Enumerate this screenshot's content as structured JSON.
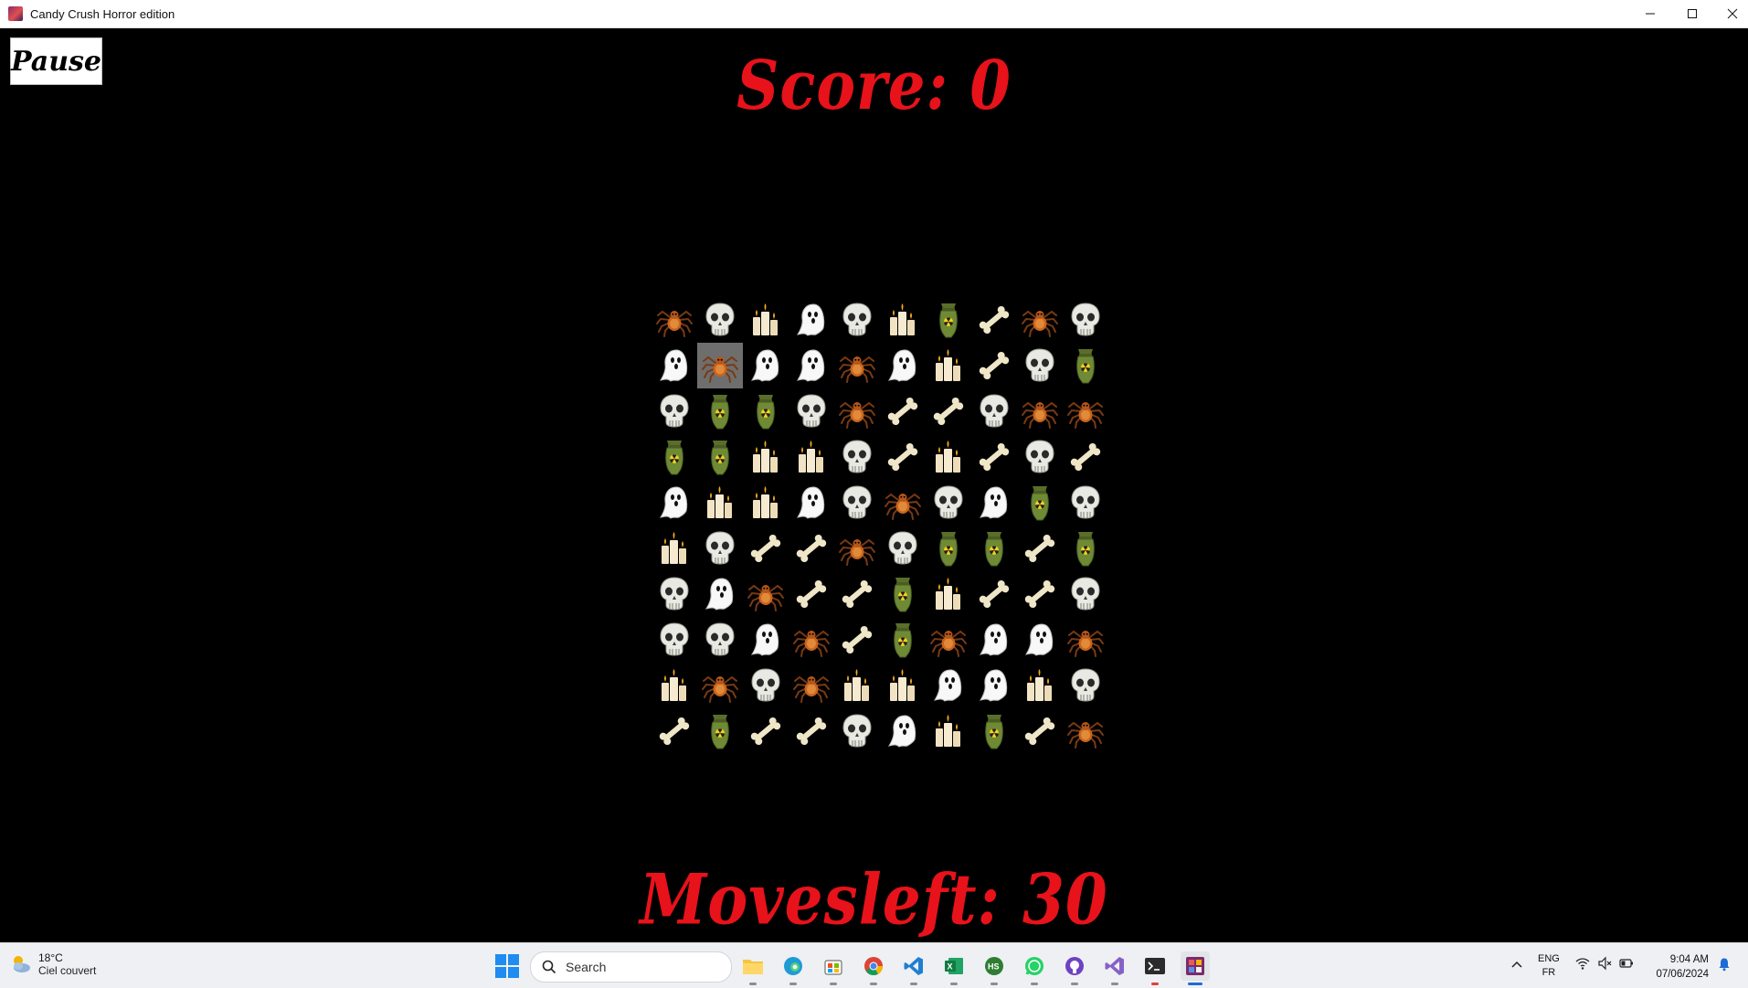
{
  "window": {
    "title": "Candy Crush Horror edition"
  },
  "game": {
    "pause_label": "Pause",
    "score_label": "Score: 0",
    "moves_label": "Movesleft: 30",
    "board_rows": [
      [
        "spider",
        "skull",
        "candles",
        "ghost",
        "skull",
        "candles",
        "bomb",
        "bone",
        "spider",
        "skull"
      ],
      [
        "ghost",
        "spider",
        "ghost",
        "ghost",
        "spider",
        "ghost",
        "candles",
        "bone",
        "skull",
        "bomb"
      ],
      [
        "skull",
        "bomb",
        "bomb",
        "skull",
        "spider",
        "bone",
        "bone",
        "skull",
        "spider",
        "spider"
      ],
      [
        "bomb",
        "bomb",
        "candles",
        "candles",
        "skull",
        "bone",
        "candles",
        "bone",
        "skull",
        "bone"
      ],
      [
        "ghost",
        "candles",
        "candles",
        "ghost",
        "skull",
        "spider",
        "skull",
        "ghost",
        "bomb",
        "skull"
      ],
      [
        "candles",
        "skull",
        "bone",
        "bone",
        "spider",
        "skull",
        "bomb",
        "bomb",
        "bone",
        "bomb"
      ],
      [
        "skull",
        "ghost",
        "spider",
        "bone",
        "bone",
        "bomb",
        "candles",
        "bone",
        "bone",
        "skull"
      ],
      [
        "skull",
        "skull",
        "ghost",
        "spider",
        "bone",
        "bomb",
        "spider",
        "ghost",
        "ghost",
        "spider"
      ],
      [
        "candles",
        "spider",
        "skull",
        "spider",
        "candles",
        "candles",
        "ghost",
        "ghost",
        "candles",
        "skull"
      ],
      [
        "bone",
        "bomb",
        "bone",
        "bone",
        "skull",
        "ghost",
        "candles",
        "bomb",
        "bone",
        "spider"
      ]
    ],
    "selected_cell": {
      "row": 1,
      "col": 1
    }
  },
  "taskbar": {
    "weather_temp": "18°C",
    "weather_desc": "Ciel couvert",
    "search_placeholder": "Search",
    "apps": [
      "file-explorer-icon",
      "edge-icon",
      "store-icon",
      "chrome-icon",
      "vscode-icon",
      "excel-icon",
      "hs-icon",
      "whatsapp-icon",
      "github-icon",
      "visual-studio-icon",
      "terminal-icon",
      "game-app-icon"
    ],
    "lang_line1": "ENG",
    "lang_line2": "FR",
    "time": "9:04 AM",
    "date": "07/06/2024"
  }
}
